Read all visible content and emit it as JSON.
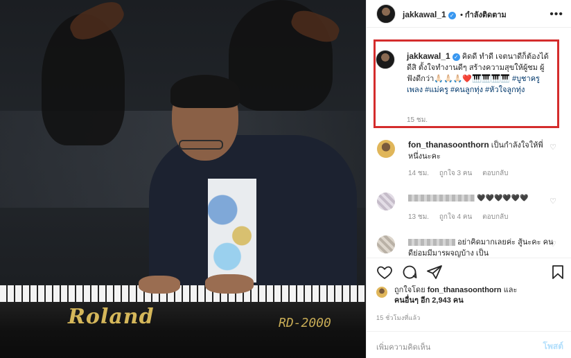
{
  "photo": {
    "brand_text": "Roland",
    "model_text": "RD-2000"
  },
  "header": {
    "username": "jakkawal_1",
    "follow_label": "• กำลังติดตาม",
    "more_icon": "more-horizontal-icon",
    "verified_icon": "verified-badge-icon"
  },
  "caption": {
    "username": "jakkawal_1",
    "text": "คิดดี ทำดี เจตนาดีก็ต้องได้ดีสิ ตั้งใจทำงานดีๆ สร้างความสุขให้ผู้ชม ผู้ฟังดีกว่า🙏🏻🙏🏻🙏🏻❤️🎹🎹🎹🎹",
    "hashtags": "#บูชาครูเพลง #แม่ครู #คนลูกทุ่ง #หัวใจลูกทุ่ง",
    "time": "15 ชม.",
    "highlight_color": "#d42c2c"
  },
  "comments": [
    {
      "username": "fon_thanasoonthorn",
      "text": "เป็นกำลังใจให้พี่หนึ่งนะคะ",
      "time": "14 ชม.",
      "likes": "ถูกใจ 3 คน",
      "reply": "ตอบกลับ"
    },
    {
      "username": "",
      "text": "🖤🖤🖤🖤🖤🖤",
      "time": "13 ชม.",
      "likes": "ถูกใจ 4 คน",
      "reply": "ตอบกลับ"
    },
    {
      "username": "",
      "text": "อย่าคิดมากเลยค่ะ สู้นะคะ คนดีย่อมมีมารผจญบ้าง เป็น",
      "time": "",
      "likes": "",
      "reply": ""
    }
  ],
  "actions": {
    "like_icon": "heart-icon",
    "comment_icon": "comment-icon",
    "share_icon": "share-icon",
    "save_icon": "bookmark-icon"
  },
  "likes": {
    "prefix": "ถูกใจโดย",
    "user": "fon_thanasoonthorn",
    "and": "และ",
    "others": "คนอื่นๆ อีก 2,943 คน"
  },
  "post_time": "15 ชั่วโมงที่แล้ว",
  "add_comment": {
    "placeholder": "เพิ่มความคิดเห็น",
    "post_label": "โพสต์"
  }
}
